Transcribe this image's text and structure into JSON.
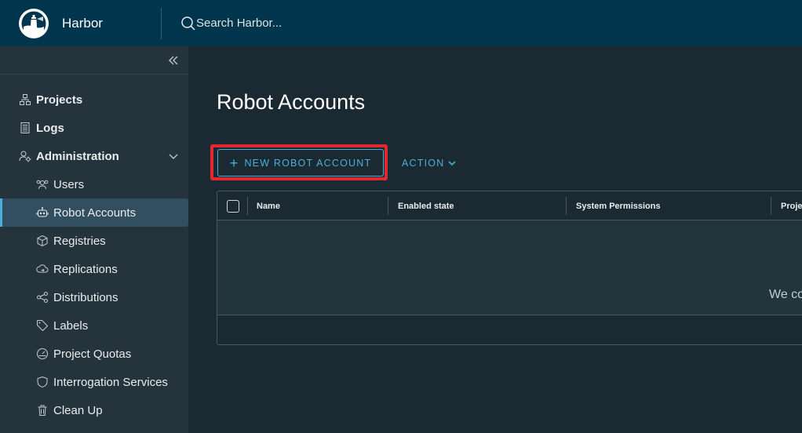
{
  "header": {
    "brand": "Harbor",
    "search_placeholder": "Search Harbor..."
  },
  "sidebar": {
    "items": [
      {
        "label": "Projects",
        "icon": "projects-icon"
      },
      {
        "label": "Logs",
        "icon": "logs-icon"
      },
      {
        "label": "Administration",
        "icon": "administration-icon"
      },
      {
        "label": "Users",
        "icon": "users-icon"
      },
      {
        "label": "Robot Accounts",
        "icon": "robot-icon"
      },
      {
        "label": "Registries",
        "icon": "registries-icon"
      },
      {
        "label": "Replications",
        "icon": "replications-icon"
      },
      {
        "label": "Distributions",
        "icon": "distributions-icon"
      },
      {
        "label": "Labels",
        "icon": "labels-icon"
      },
      {
        "label": "Project Quotas",
        "icon": "quotas-icon"
      },
      {
        "label": "Interrogation Services",
        "icon": "shield-icon"
      },
      {
        "label": "Clean Up",
        "icon": "trash-icon"
      }
    ]
  },
  "main": {
    "title": "Robot Accounts",
    "new_button": "NEW ROBOT ACCOUNT",
    "action_button": "ACTION",
    "table": {
      "columns": [
        "Name",
        "Enabled state",
        "System Permissions",
        "Proje"
      ],
      "empty_text": "We co"
    }
  },
  "colors": {
    "header_bg": "#00364d",
    "sidebar_bg": "#25343c",
    "accent": "#49afd9",
    "highlight": "#e12a2f"
  }
}
